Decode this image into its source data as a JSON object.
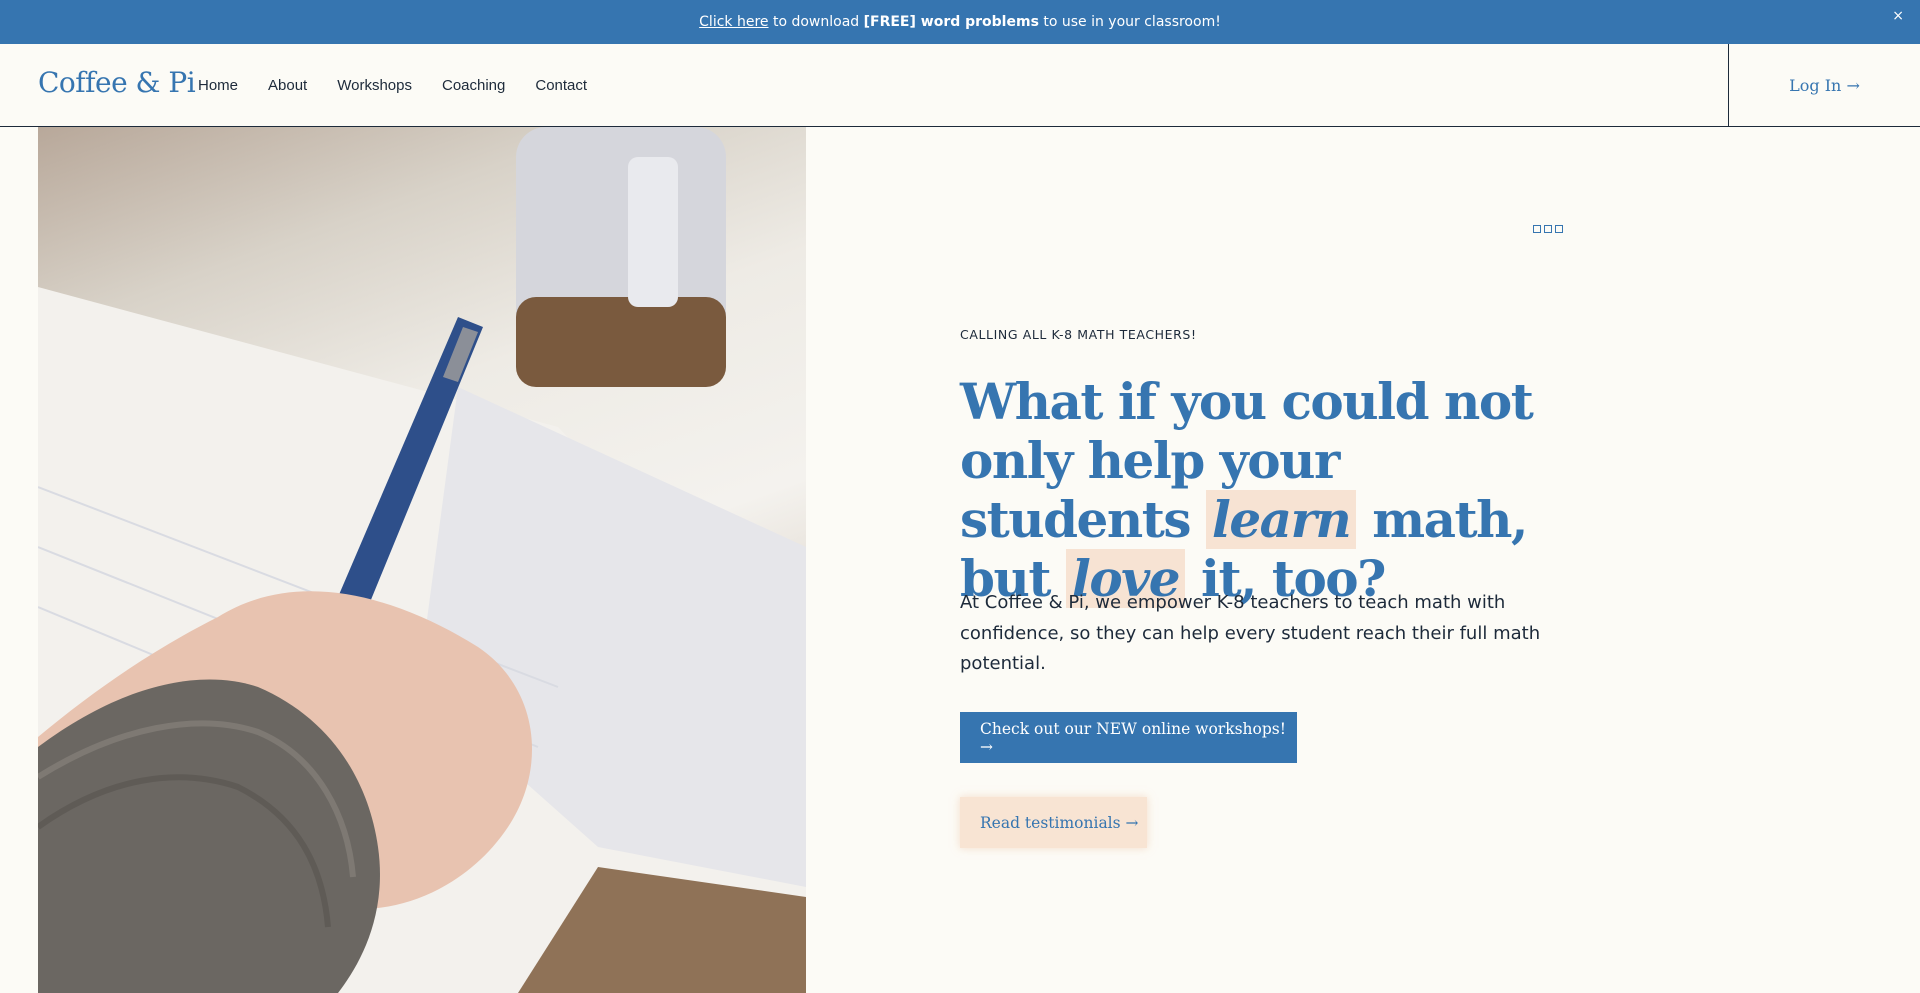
{
  "announcement": {
    "link_text": "Click here",
    "text_before": " to download ",
    "bold_text": "[FREE] word problems",
    "text_after": " to use in your classroom!",
    "close_icon": "×"
  },
  "header": {
    "logo": "Coffee & Pi",
    "nav": [
      "Home",
      "About",
      "Workshops",
      "Coaching",
      "Contact"
    ],
    "login": "Log In →"
  },
  "hero": {
    "eyebrow": "CALLING ALL K-8 MATH TEACHERS!",
    "headline": {
      "part1": "What if you could not only help your students ",
      "em1": "learn",
      "part2": " math, but ",
      "em2": "love",
      "part3": " it, too?"
    },
    "description": "At Coffee & Pi, we empower K-8 teachers to teach math with confidence, so they can help every student reach their full math potential.",
    "primary_button": "Check out our NEW online workshops! →",
    "secondary_button": "Read testimonials →"
  },
  "colors": {
    "brand_blue": "#3675b0",
    "background": "#fcfbf6",
    "highlight": "#f7e3d3",
    "text_dark": "#1d2a3a"
  }
}
